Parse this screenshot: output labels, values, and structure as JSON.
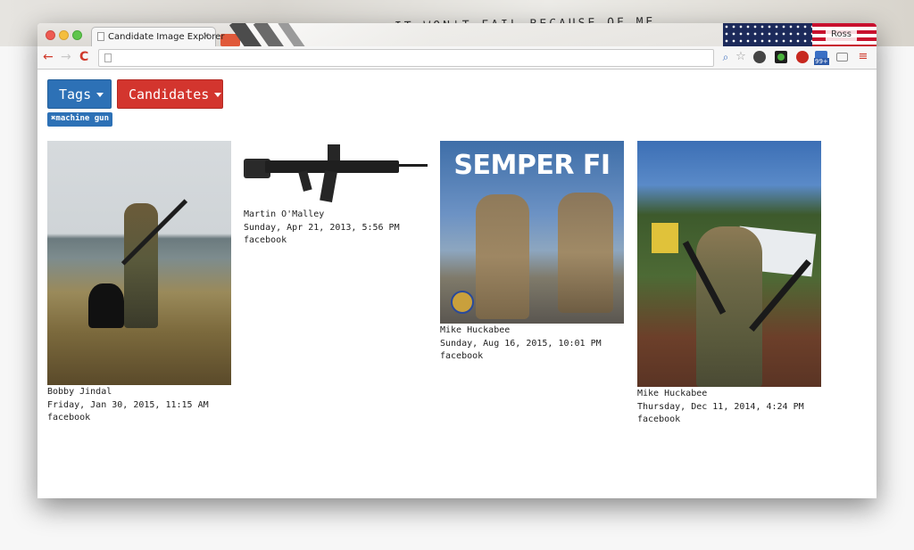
{
  "wallpaper": {
    "scrawl_text": "IT WON'T FAIL BECAUSE OF ME"
  },
  "browser": {
    "tab_title": "Candidate Image Explorer",
    "tab_close": "×",
    "profile_name": "Ross",
    "nav": {
      "back": "←",
      "forward": "→",
      "reload": "C",
      "menu": "≡"
    },
    "extensions": {
      "zoom": "⌕",
      "star": "☆",
      "badge_count": "99+"
    }
  },
  "filters": {
    "tags_label": "Tags",
    "candidates_label": "Candidates",
    "active_tag": "✖machine gun"
  },
  "images": [
    {
      "alt": "Hunter with rifle and black dog in marsh",
      "candidate": "Bobby Jindal",
      "date": "Friday, Jan 30, 2015, 11:15 AM",
      "source": "facebook"
    },
    {
      "alt": "Assault rifle",
      "candidate": "Martin O'Malley",
      "date": "Sunday, Apr 21, 2013, 5:56 PM",
      "source": "facebook"
    },
    {
      "alt": "Marines with rifles under SEMPER FI headline",
      "headline": "SEMPER FI",
      "candidate": "Mike Huckabee",
      "date": "Sunday, Aug 16, 2015, 10:01 PM",
      "source": "facebook"
    },
    {
      "alt": "Man in camouflage holding two guns",
      "candidate": "Mike Huckabee",
      "date": "Thursday, Dec 11, 2014, 4:24 PM",
      "source": "facebook"
    }
  ]
}
